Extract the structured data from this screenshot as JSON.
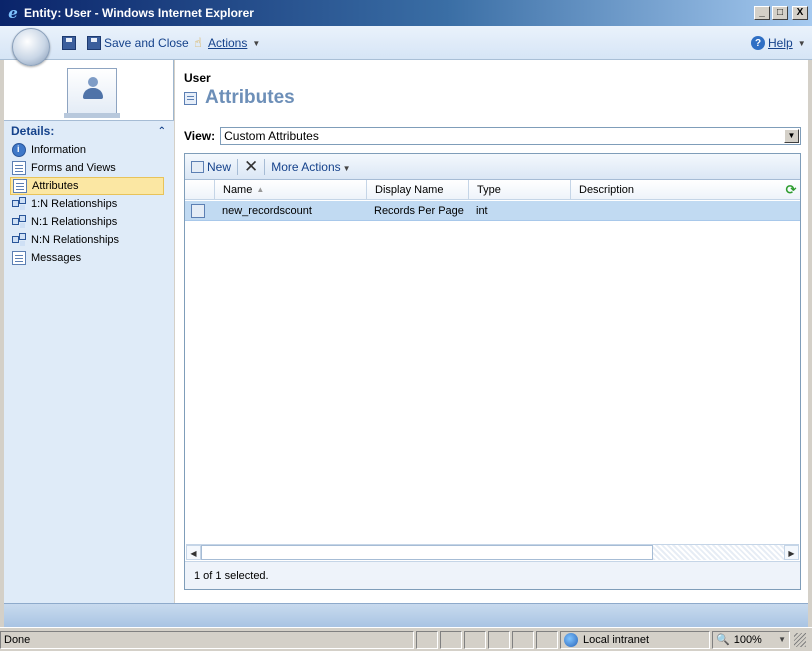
{
  "window": {
    "title": "Entity: User - Windows Internet Explorer",
    "btn_minimize": "_",
    "btn_maximize": "□",
    "btn_close": "X"
  },
  "toolbar": {
    "save_and_close": "Save and Close",
    "actions": "Actions",
    "help": "Help"
  },
  "left_panel": {
    "details_header": "Details:",
    "items": [
      {
        "label": "Information",
        "icon": "info-icon"
      },
      {
        "label": "Forms and Views",
        "icon": "forms-icon"
      },
      {
        "label": "Attributes",
        "icon": "attributes-icon",
        "selected": true
      },
      {
        "label": "1:N Relationships",
        "icon": "relationship-icon"
      },
      {
        "label": "N:1 Relationships",
        "icon": "relationship-icon"
      },
      {
        "label": "N:N Relationships",
        "icon": "relationship-icon"
      },
      {
        "label": "Messages",
        "icon": "messages-icon"
      }
    ]
  },
  "main": {
    "entity": "User",
    "page_title": "Attributes",
    "view_label": "View:",
    "view_value": "Custom Attributes",
    "grid_toolbar": {
      "new": "New",
      "more_actions": "More Actions"
    },
    "columns": [
      "Name",
      "Display Name",
      "Type",
      "Description"
    ],
    "rows": [
      {
        "name": "new_recordscount",
        "display_name": "Records Per Page",
        "type": "int",
        "description": ""
      }
    ],
    "footer": "1 of 1 selected."
  },
  "statusbar": {
    "status": "Done",
    "zone": "Local intranet",
    "zoom": "100%"
  },
  "colors": {
    "accent": "#15428b",
    "selected_row": "#c1daf2",
    "selected_nav": "#fbe7a3",
    "title_text": "#6d8fb8"
  }
}
